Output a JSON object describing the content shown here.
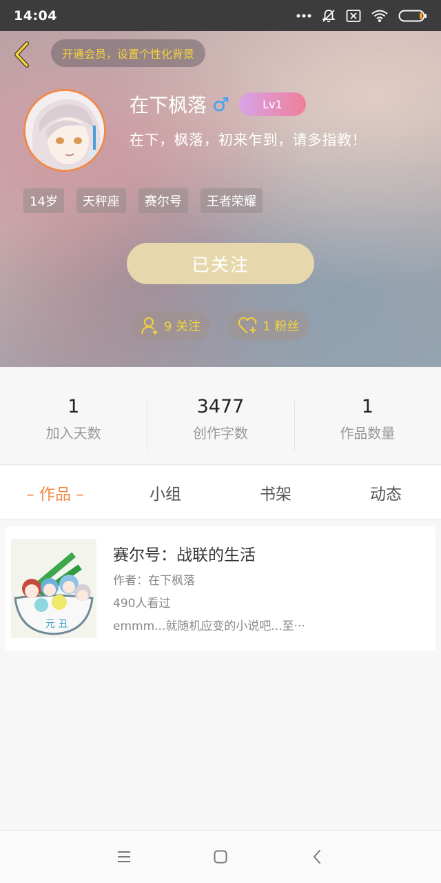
{
  "status_bar": {
    "time": "14:04",
    "icons": [
      "more-dots-icon",
      "bell-off-icon",
      "sim-off-icon",
      "wifi-icon",
      "battery-icon"
    ]
  },
  "header": {
    "back_icon": "chevron-left-icon",
    "vip_text": "开通会员，设置个性化背景",
    "username": "在下枫落",
    "gender_symbol": "♂",
    "level": "Lv1",
    "bio": "在下，枫落，初来乍到，请多指教！",
    "tags": [
      "14岁",
      "天秤座",
      "赛尔号",
      "王者荣耀"
    ],
    "follow_button": "已关注",
    "following_count": "9 关注",
    "followers_count": "1 粉丝"
  },
  "stats": [
    {
      "value": "1",
      "label": "加入天数"
    },
    {
      "value": "3477",
      "label": "创作字数"
    },
    {
      "value": "1",
      "label": "作品数量"
    }
  ],
  "tabs": [
    {
      "label": "– 作品 –",
      "active": true
    },
    {
      "label": "小组",
      "active": false
    },
    {
      "label": "书架",
      "active": false
    },
    {
      "label": "动态",
      "active": false
    }
  ],
  "works": [
    {
      "title": "赛尔号：战联的生活",
      "author": "作者：在下枫落",
      "views": "490人看过",
      "description": "emmm...就随机应变的小说吧...至···"
    }
  ],
  "nav_bar": {
    "icons": [
      "menu-icon",
      "home-icon",
      "back-icon"
    ]
  },
  "colors": {
    "accent_orange": "#ef8a49",
    "vip_gold": "#f3d33c",
    "follow_button": "#e6d7ad",
    "gender_blue": "#3fa2f0"
  }
}
